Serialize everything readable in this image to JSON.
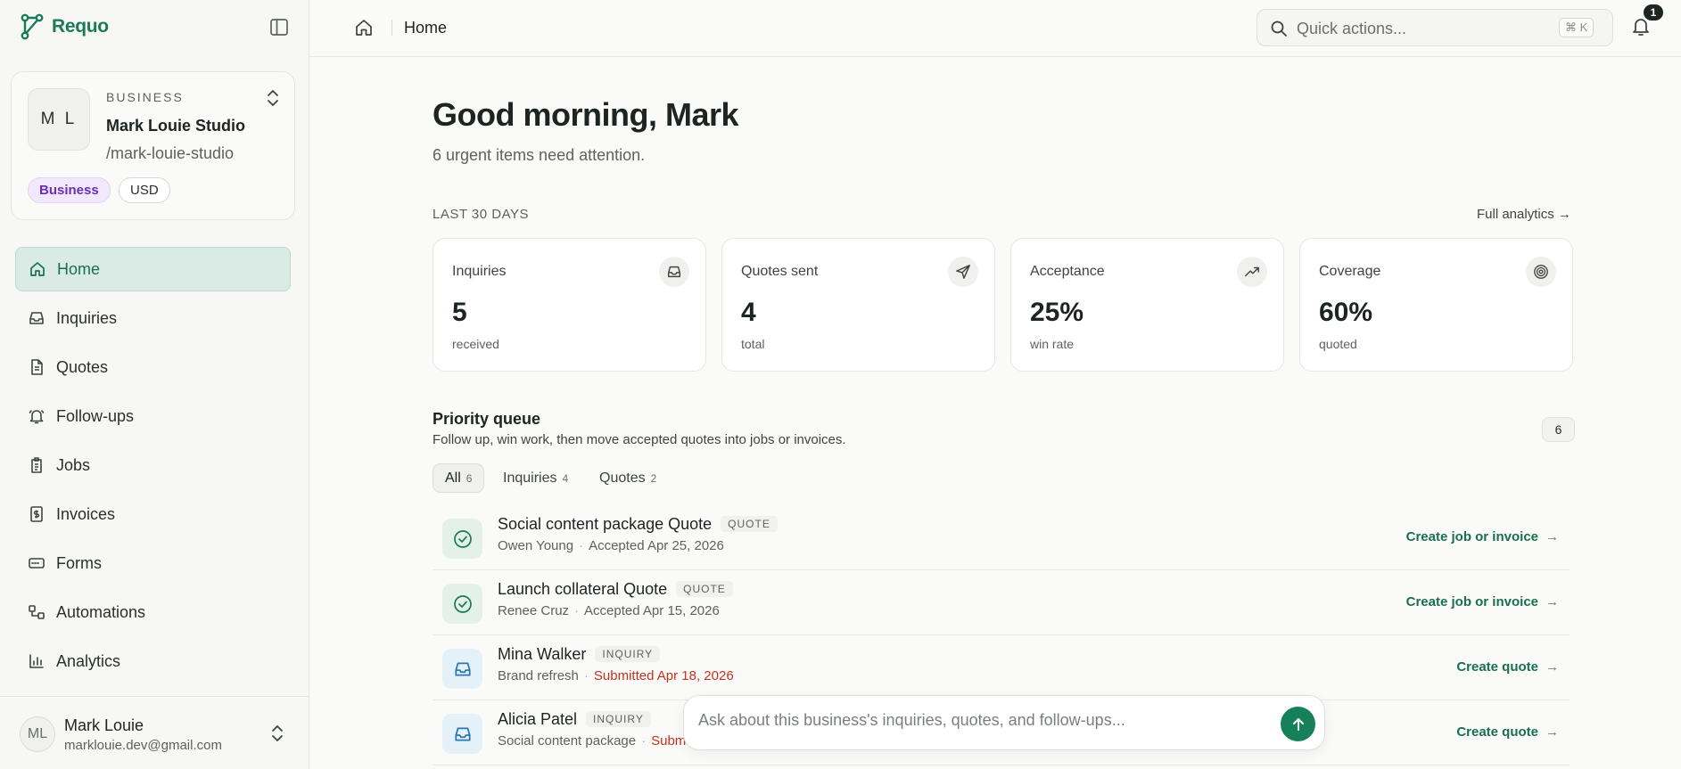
{
  "brand": {
    "name": "Requo"
  },
  "business": {
    "initials": "M L",
    "label": "BUSINESS",
    "name": "Mark Louie Studio",
    "slug": "/mark-louie-studio",
    "plan": "Business",
    "currency": "USD"
  },
  "nav": [
    {
      "label": "Home",
      "icon": "home-icon"
    },
    {
      "label": "Inquiries",
      "icon": "inbox-icon"
    },
    {
      "label": "Quotes",
      "icon": "document-icon"
    },
    {
      "label": "Follow-ups",
      "icon": "bell-ring-icon"
    },
    {
      "label": "Jobs",
      "icon": "clipboard-icon"
    },
    {
      "label": "Invoices",
      "icon": "invoice-icon"
    },
    {
      "label": "Forms",
      "icon": "form-icon"
    },
    {
      "label": "Automations",
      "icon": "workflow-icon"
    },
    {
      "label": "Analytics",
      "icon": "bar-chart-icon"
    }
  ],
  "user": {
    "initials": "ML",
    "name": "Mark Louie",
    "email": "marklouie.dev@gmail.com"
  },
  "topbar": {
    "crumb": "Home",
    "search_placeholder": "Quick actions...",
    "shortcut": "⌘ K",
    "notifications": "1"
  },
  "main": {
    "greeting": "Good morning, Mark",
    "subtitle": "6 urgent items need attention.",
    "period": "LAST 30 DAYS",
    "full_analytics": "Full analytics",
    "stats": [
      {
        "title": "Inquiries",
        "value": "5",
        "sub": "received",
        "icon": "inbox-icon"
      },
      {
        "title": "Quotes sent",
        "value": "4",
        "sub": "total",
        "icon": "send-icon"
      },
      {
        "title": "Acceptance",
        "value": "25%",
        "sub": "win rate",
        "icon": "trending-up-icon"
      },
      {
        "title": "Coverage",
        "value": "60%",
        "sub": "quoted",
        "icon": "target-icon"
      }
    ],
    "queue": {
      "title": "Priority queue",
      "subtitle": "Follow up, win work, then move accepted quotes into jobs or invoices.",
      "count": "6",
      "tabs": [
        {
          "label": "All",
          "count": "6"
        },
        {
          "label": "Inquiries",
          "count": "4"
        },
        {
          "label": "Quotes",
          "count": "2"
        }
      ],
      "rows": [
        {
          "title": "Social content package Quote",
          "tag": "QUOTE",
          "person": "Owen Young",
          "status": "Accepted Apr 25, 2026",
          "action": "Create job or invoice"
        },
        {
          "title": "Launch collateral Quote",
          "tag": "QUOTE",
          "person": "Renee Cruz",
          "status": "Accepted Apr 15, 2026",
          "action": "Create job or invoice"
        },
        {
          "title": "Mina Walker",
          "tag": "INQUIRY",
          "person": "Brand refresh",
          "status": "Submitted Apr 18, 2026",
          "action": "Create quote"
        },
        {
          "title": "Alicia Patel",
          "tag": "INQUIRY",
          "person": "Social content package",
          "status": "Subm",
          "action": "Create quote"
        }
      ]
    },
    "ask_placeholder": "Ask about this business's inquiries, quotes, and follow-ups..."
  },
  "colors": {
    "accent": "#1a7a5a",
    "urgent": "#c4321f",
    "send_button": "#16805a"
  }
}
